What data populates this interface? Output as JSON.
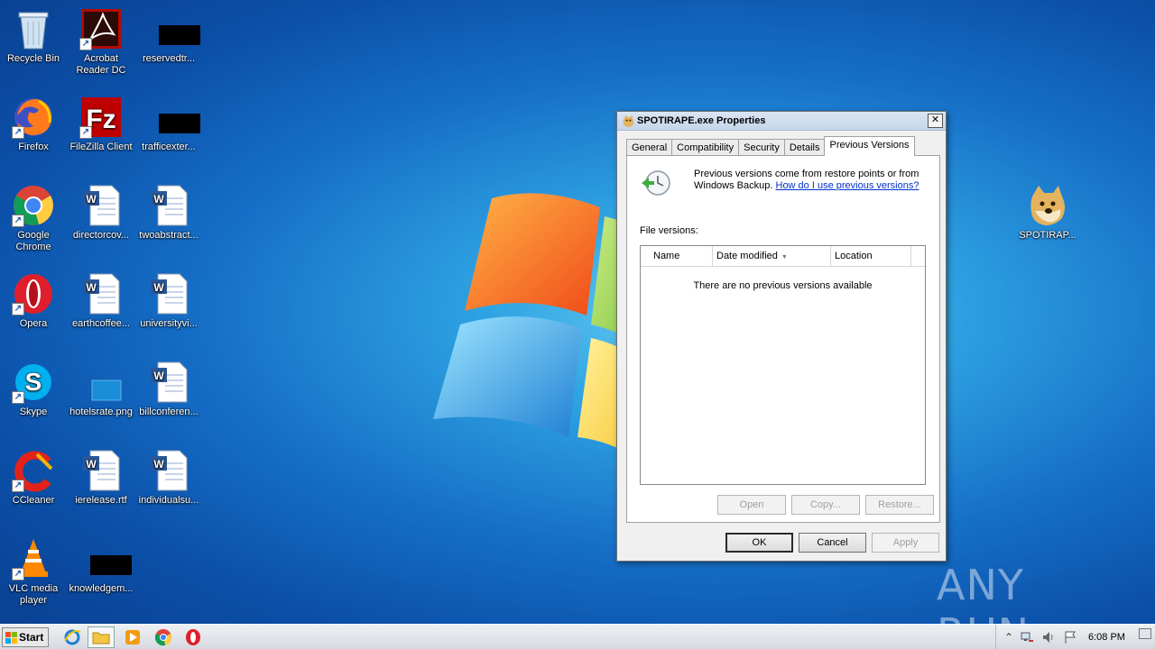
{
  "desktop": {
    "icons": [
      {
        "label": "Recycle Bin",
        "icon": "recycle-bin-icon"
      },
      {
        "label": "Acrobat Reader DC",
        "icon": "acrobat-icon"
      },
      {
        "label": "reservedtr...",
        "icon": "file-icon"
      },
      {
        "label": "Firefox",
        "icon": "firefox-icon"
      },
      {
        "label": "FileZilla Client",
        "icon": "filezilla-icon"
      },
      {
        "label": "trafficexter...",
        "icon": "file-icon"
      },
      {
        "label": "Google Chrome",
        "icon": "chrome-icon"
      },
      {
        "label": "directorcov...",
        "icon": "word-doc-icon"
      },
      {
        "label": "twoabstract...",
        "icon": "word-doc-icon"
      },
      {
        "label": "Opera",
        "icon": "opera-icon"
      },
      {
        "label": "earthcoffee...",
        "icon": "word-doc-icon"
      },
      {
        "label": "universityvi...",
        "icon": "word-doc-icon"
      },
      {
        "label": "Skype",
        "icon": "skype-icon"
      },
      {
        "label": "hotelsrate.png",
        "icon": "image-file-icon"
      },
      {
        "label": "billconferen...",
        "icon": "word-doc-icon"
      },
      {
        "label": "CCleaner",
        "icon": "ccleaner-icon"
      },
      {
        "label": "ierelease.rtf",
        "icon": "word-doc-icon"
      },
      {
        "label": "individualsu...",
        "icon": "word-doc-icon"
      },
      {
        "label": "VLC media player",
        "icon": "vlc-icon"
      },
      {
        "label": "knowledgem...",
        "icon": "file-icon"
      },
      {
        "label": "SPOTIRAP...",
        "icon": "doge-icon"
      }
    ]
  },
  "dialog": {
    "title": "SPOTIRAPE.exe Properties",
    "close_label": "✕",
    "tabs": [
      {
        "label": "General"
      },
      {
        "label": "Compatibility"
      },
      {
        "label": "Security"
      },
      {
        "label": "Details"
      },
      {
        "label": "Previous Versions"
      }
    ],
    "active_tab": "Previous Versions",
    "description": "Previous versions come from restore points or from Windows Backup.",
    "help_link": "How do I use previous versions?",
    "file_versions_label": "File versions:",
    "columns": {
      "name": "Name",
      "date": "Date modified",
      "location": "Location"
    },
    "empty_message": "There are no previous versions available",
    "actions": {
      "open": "Open",
      "copy": "Copy...",
      "restore": "Restore..."
    },
    "footer": {
      "ok": "OK",
      "cancel": "Cancel",
      "apply": "Apply"
    }
  },
  "watermark": {
    "text": "ANY RUN"
  },
  "taskbar": {
    "start_label": "Start",
    "clock": "6:08 PM",
    "tray_expand": "⌃"
  },
  "colors": {
    "desktop_blue": "#1670c8",
    "link": "#0033cc"
  }
}
